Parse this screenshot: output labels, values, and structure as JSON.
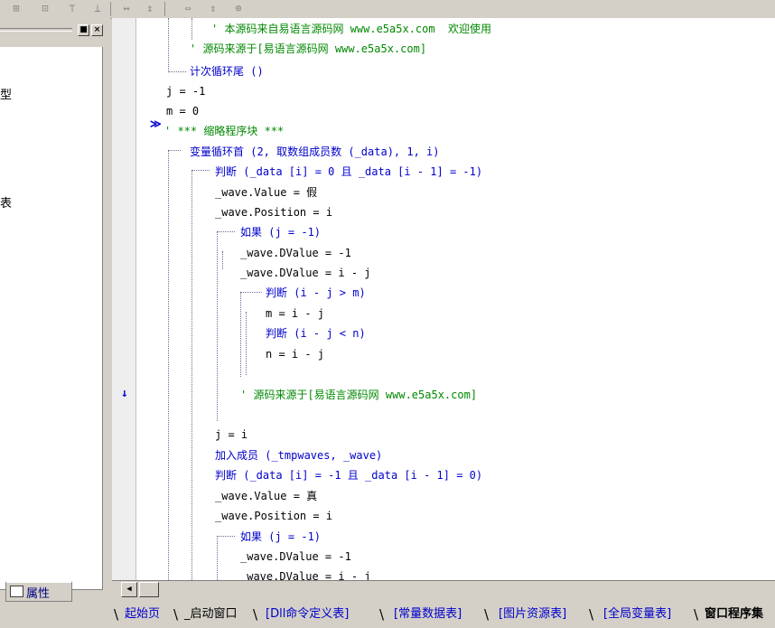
{
  "left_panel": {
    "fragments": [
      "型",
      "表"
    ],
    "tab_label": "属性"
  },
  "editor": {
    "lines": [
      {
        "text": "' 本源码来自易语言源码网 www.e5a5x.com  欢迎使用",
        "cls": "c"
      },
      {
        "text": "' 源码来源于[易语言源码网 www.e5a5x.com]",
        "cls": "c"
      },
      {
        "text": "计次循环尾 ()",
        "cls": "k"
      },
      {
        "text": "j = -1",
        "cls": "d"
      },
      {
        "text": "m = 0",
        "cls": "d"
      },
      {
        "text": "' *** 缩略程序块 ***",
        "cls": "c"
      },
      {
        "text": "变量循环首 (2, 取数组成员数 (_data), 1, i)",
        "cls": "k"
      },
      {
        "text": "判断 (_data [i] = 0 且 _data [i - 1] = -1)",
        "cls": "k"
      },
      {
        "text": "_wave.Value = 假",
        "cls": "d"
      },
      {
        "text": "_wave.Position = i",
        "cls": "d"
      },
      {
        "text": "如果 (j = -1)",
        "cls": "k"
      },
      {
        "text": "_wave.DValue = -1",
        "cls": "d"
      },
      {
        "text": "_wave.DValue = i - j",
        "cls": "d"
      },
      {
        "text": "判断 (i - j > m)",
        "cls": "k"
      },
      {
        "text": "m = i - j",
        "cls": "d"
      },
      {
        "text": "判断 (i - j < n)",
        "cls": "k"
      },
      {
        "text": "n = i - j",
        "cls": "d"
      },
      {
        "text": "",
        "cls": "d"
      },
      {
        "text": "' 源码来源于[易语言源码网 www.e5a5x.com]",
        "cls": "c"
      },
      {
        "text": "",
        "cls": "d"
      },
      {
        "text": "j = i",
        "cls": "d"
      },
      {
        "text": "加入成员 (_tmpwaves, _wave)",
        "cls": "k"
      },
      {
        "text": "判断 (_data [i] = -1 且 _data [i - 1] = 0)",
        "cls": "k"
      },
      {
        "text": "_wave.Value = 真",
        "cls": "d"
      },
      {
        "text": "_wave.Position = i",
        "cls": "d"
      },
      {
        "text": "如果 (j = -1)",
        "cls": "k"
      },
      {
        "text": "_wave.DValue = -1",
        "cls": "d"
      },
      {
        "text": "_wave.DValue = i - j",
        "cls": "d"
      }
    ],
    "current_line_marker": "↓",
    "fold_marker": "≫"
  },
  "tabs": [
    {
      "label": "起始页",
      "active": false
    },
    {
      "label": "_启动窗口",
      "active": false
    },
    {
      "label": "[Dll命令定义表]",
      "active": false
    },
    {
      "label": "[常量数据表]",
      "active": false
    },
    {
      "label": "[图片资源表]",
      "active": false
    },
    {
      "label": "[全局变量表]",
      "active": false
    },
    {
      "label": "窗口程序集",
      "active": true
    }
  ]
}
